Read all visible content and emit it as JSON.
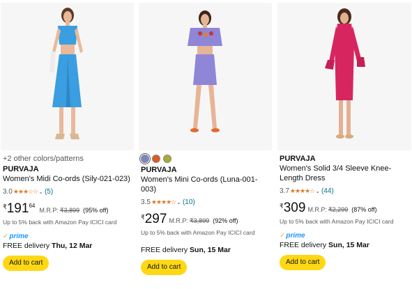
{
  "products": [
    {
      "more_colors": "+2 other colors/patterns",
      "brand": "PURVAJA",
      "title": "Women's Midi Co-ords (Sily-021-023)",
      "rating": "3.0",
      "stars": "★★★☆☆",
      "reviews": "(5)",
      "currency": "₹",
      "price_whole": "191",
      "price_fraction": "64",
      "mrp_label": "M.R.P:",
      "mrp": "₹3,899",
      "discount": "(95% off)",
      "cashback": "Up to 5% back with Amazon Pay ICICI card",
      "prime": "prime",
      "delivery_prefix": "FREE delivery",
      "delivery_date": "Thu, 12 Mar",
      "add_to_cart": "Add to cart",
      "image_desc_icon": "product-photo-blue-coord"
    },
    {
      "swatch_colors": [
        "#7b86c9",
        "#e05a1e",
        "#a7ad2f"
      ],
      "brand": "PURVAJA",
      "title": "Women's Mini Co-ords (Luna-001-003)",
      "rating": "3.5",
      "stars": "★★★★☆",
      "reviews": "(10)",
      "currency": "₹",
      "price_whole": "297",
      "mrp_label": "M.R.P:",
      "mrp": "₹3,899",
      "discount": "(92% off)",
      "cashback": "Up to 5% back with Amazon Pay ICICI card",
      "delivery_prefix": "FREE delivery",
      "delivery_date": "Sun, 15 Mar",
      "add_to_cart": "Add to cart"
    },
    {
      "brand": "PURVAJA",
      "title_line1": "Women's Solid 3/4 Sleeve Knee-",
      "title_line2": "Length Dress",
      "rating": "3.7",
      "stars": "★★★★☆",
      "reviews": "(44)",
      "currency": "₹",
      "price_whole": "309",
      "mrp_label": "M.R.P:",
      "mrp": "₹2,299",
      "discount": "(87% off)",
      "cashback": "Up to 5% back with Amazon Pay ICICI card",
      "prime": "prime",
      "delivery_prefix": "FREE delivery",
      "delivery_date": "Sun, 15 Mar",
      "add_to_cart": "Add to cart"
    }
  ],
  "colors": {
    "star": "#de7921",
    "link": "#007185",
    "button": "#ffd814",
    "prime_blue": "#1a98ff",
    "prime_check": "#f3a847",
    "outfit_1": "#3a9ee0",
    "outfit_2": "#8f86d8",
    "outfit_3": "#d7265f"
  }
}
